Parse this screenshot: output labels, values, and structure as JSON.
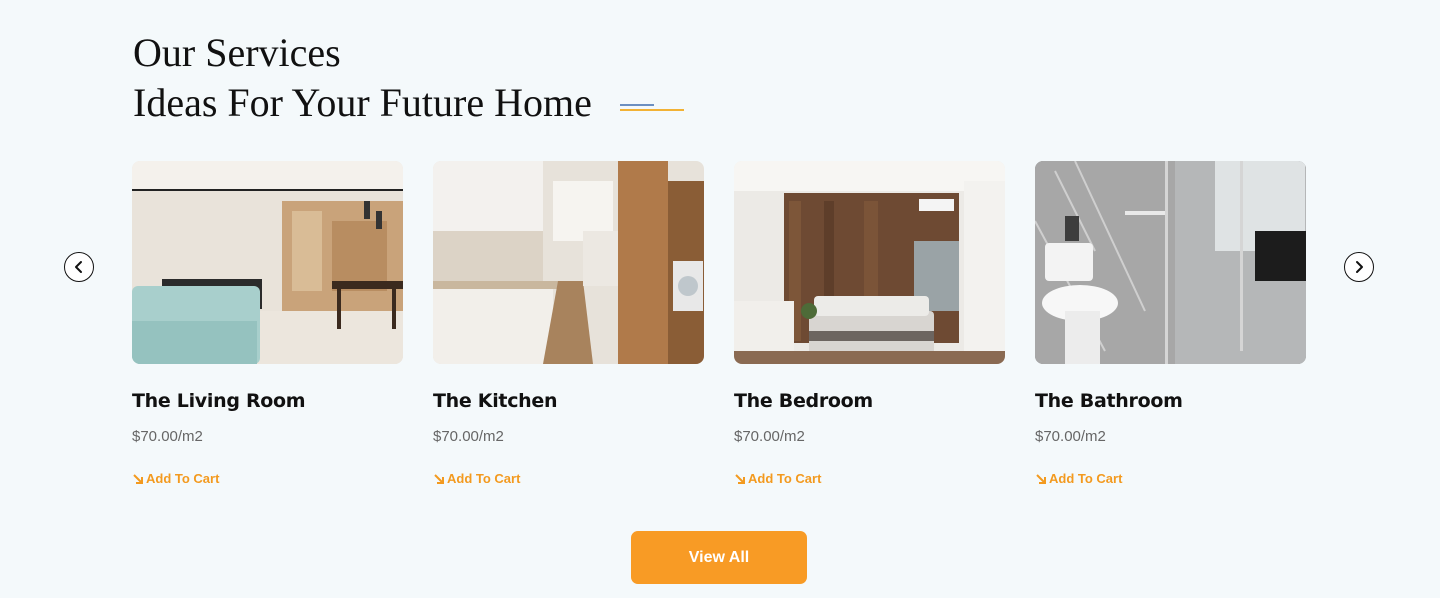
{
  "section": {
    "title_line1": "Our Services",
    "title_line2": "Ideas For Your Future Home"
  },
  "carousel": {
    "prev_icon": "chevron-left-icon",
    "next_icon": "chevron-right-icon"
  },
  "cards": [
    {
      "title": "The Living Room",
      "price": "$70.00/m2",
      "cart_label": "Add To Cart",
      "image": "living-room-photo"
    },
    {
      "title": "The Kitchen",
      "price": "$70.00/m2",
      "cart_label": "Add To Cart",
      "image": "kitchen-photo"
    },
    {
      "title": "The Bedroom",
      "price": "$70.00/m2",
      "cart_label": "Add To Cart",
      "image": "bedroom-photo"
    },
    {
      "title": "The Bathroom",
      "price": "$70.00/m2",
      "cart_label": "Add To Cart",
      "image": "bathroom-photo"
    }
  ],
  "view_all_label": "View All",
  "colors": {
    "accent": "#f89b25",
    "background": "#f4f9fb",
    "deco_blue": "#6c8fc0",
    "deco_yellow": "#f2b234"
  }
}
